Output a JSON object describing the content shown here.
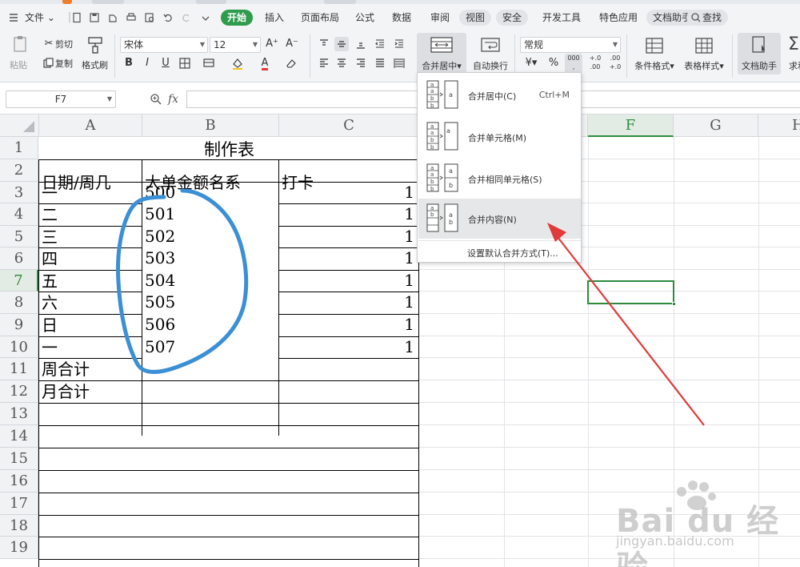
{
  "menubar": {
    "file_label": "文件",
    "tabs": [
      "开始",
      "插入",
      "页面布局",
      "公式",
      "数据",
      "审阅",
      "视图",
      "安全",
      "开发工具",
      "特色应用",
      "文档助手"
    ],
    "search_label": "查找"
  },
  "ribbon": {
    "paste_label": "粘贴",
    "cut_label": "剪切",
    "copy_label": "复制",
    "format_painter_label": "格式刷",
    "font_name": "宋体",
    "font_size": "12",
    "bold": "B",
    "italic": "I",
    "underline": "U",
    "font_color_letter": "A",
    "grow_font": "A⁺",
    "shrink_font": "A⁻",
    "merge_center_label": "合并居中",
    "wrap_text_label": "自动换行",
    "number_format": "常规",
    "percent": "%",
    "thousands": "000",
    "inc_decimal": "+.0 .00",
    "dec_decimal": ".00 +.0",
    "conditional_format_label": "条件格式",
    "table_style_label": "表格样式",
    "doc_assistant_label": "文档助手",
    "sum_label": "求和"
  },
  "formula_bar": {
    "cell_ref": "F7",
    "fx": "fx"
  },
  "sheet": {
    "columns": [
      "A",
      "B",
      "C",
      "F",
      "G",
      "H"
    ],
    "rows": [
      "1",
      "2",
      "3",
      "4",
      "5",
      "6",
      "7",
      "8",
      "9",
      "10",
      "11",
      "12",
      "13",
      "14",
      "15",
      "16",
      "17",
      "18",
      "19"
    ],
    "title": "制作表",
    "headers": [
      "日期/周几",
      "大单金额名系",
      "打卡"
    ],
    "col_a": [
      "一",
      "二",
      "三",
      "四",
      "五",
      "六",
      "日",
      "一",
      "周合计",
      "月合计"
    ],
    "col_b": [
      "500",
      "501",
      "502",
      "503",
      "504",
      "505",
      "506",
      "507"
    ],
    "col_c": [
      "1",
      "1",
      "1",
      "1",
      "1",
      "1",
      "1",
      "1"
    ]
  },
  "dropdown": {
    "items": [
      {
        "label": "合并居中(C)",
        "shortcut": "Ctrl+M"
      },
      {
        "label": "合并单元格(M)",
        "shortcut": ""
      },
      {
        "label": "合并相同单元格(S)",
        "shortcut": ""
      },
      {
        "label": "合并内容(N)",
        "shortcut": ""
      }
    ],
    "footer": "设置默认合并方式(T)..."
  },
  "watermark": {
    "brand": "Bai du 经验",
    "url": "jingyan.baidu.com"
  },
  "colors": {
    "accent": "#2e9c4c",
    "selection": "#2e8b3e",
    "annotation_circle": "#3a8fd6",
    "annotation_arrow": "#e03a3a"
  }
}
